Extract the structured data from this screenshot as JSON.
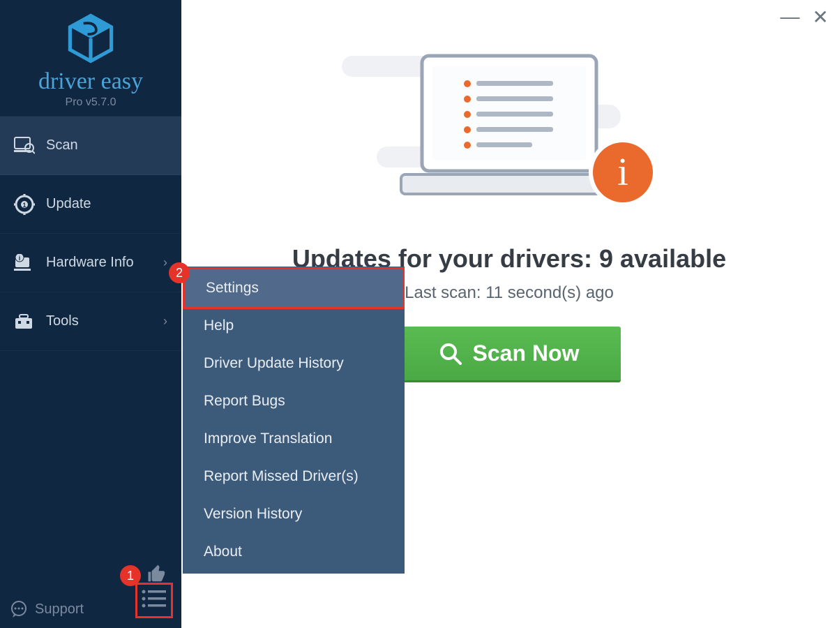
{
  "app": {
    "name": "driver easy",
    "version_label": "Pro v5.7.0"
  },
  "sidebar": {
    "items": [
      {
        "label": "Scan",
        "icon": "monitor-search",
        "active": true
      },
      {
        "label": "Update",
        "icon": "gear-badge"
      },
      {
        "label": "Hardware Info",
        "icon": "device-info",
        "expandable": true
      },
      {
        "label": "Tools",
        "icon": "toolbox",
        "expandable": true
      }
    ],
    "support_label": "Support"
  },
  "popup_menu": {
    "items": [
      "Settings",
      "Help",
      "Driver Update History",
      "Report Bugs",
      "Improve Translation",
      "Report Missed Driver(s)",
      "Version History",
      "About"
    ],
    "highlighted_index": 0
  },
  "main": {
    "headline_prefix": "Updates for your drivers: ",
    "headline_count": "9 available",
    "last_scan": "Last scan: 11 second(s) ago",
    "scan_button": "Scan Now"
  },
  "annotations": {
    "badge1": "1",
    "badge2": "2"
  }
}
